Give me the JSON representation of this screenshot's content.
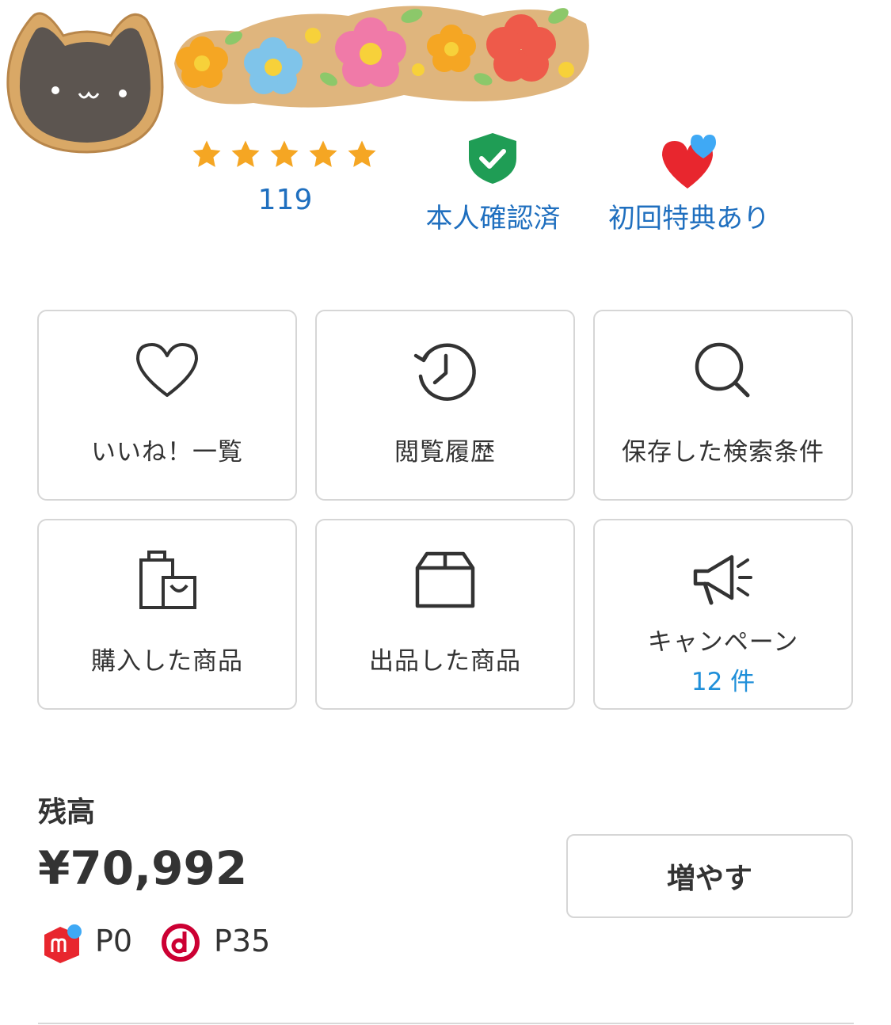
{
  "profile": {
    "rating_count": "119",
    "rating_stars": 5,
    "verified_label": "本人確認済",
    "first_benefit_label": "初回特典あり"
  },
  "menu": {
    "likes_label": "いいね！一覧",
    "history_label": "閲覧履歴",
    "saved_search_label": "保存した検索条件",
    "purchased_label": "購入した商品",
    "listed_label": "出品した商品",
    "campaign_label": "キャンペーン",
    "campaign_count": "12 件"
  },
  "balance": {
    "title": "残高",
    "amount": "¥70,992",
    "increase_button": "増やす",
    "merpay_points": "P0",
    "d_points": "P35"
  },
  "colors": {
    "link_blue": "#1f6fbf",
    "campaign_blue": "#1f8fd9",
    "star_gold": "#f5a623",
    "verify_green": "#1f9d55",
    "heart_red": "#e8262e",
    "merpay_red": "#e8262e",
    "dpoint_red": "#cc0033"
  }
}
